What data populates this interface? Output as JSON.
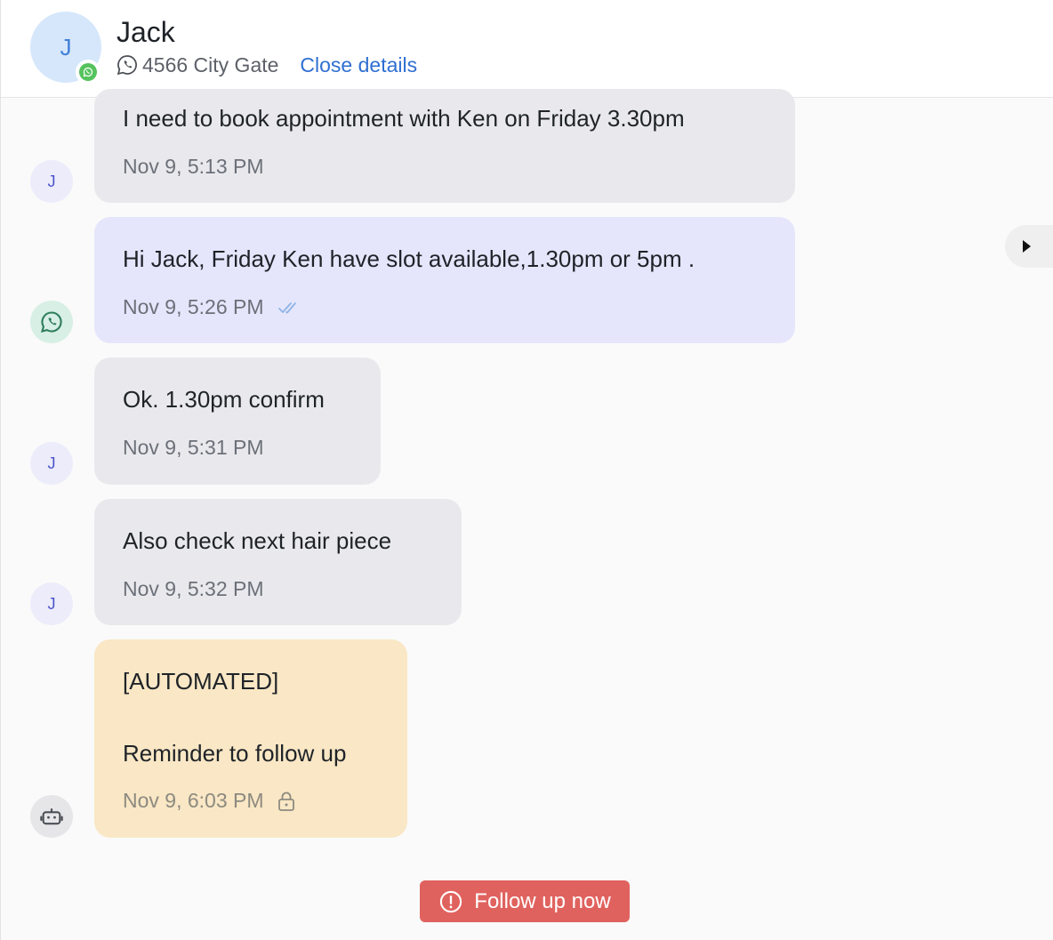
{
  "contact": {
    "initial": "J",
    "name": "Jack",
    "location": "4566 City Gate",
    "close_details_label": "Close details",
    "badge_icon": "whatsapp-icon"
  },
  "messages": [
    {
      "sender": "contact",
      "avatar_initial": "J",
      "text": "I need to book appointment with Ken on Friday 3.30pm",
      "time": "Nov 9, 5:13 PM"
    },
    {
      "sender": "agent",
      "avatar_icon": "whatsapp-icon",
      "text": "Hi Jack, Friday Ken have slot available,1.30pm or 5pm .",
      "time": "Nov 9, 5:26 PM",
      "status_icon": "double-check-icon"
    },
    {
      "sender": "contact",
      "avatar_initial": "J",
      "text": "Ok. 1.30pm confirm",
      "time": "Nov 9, 5:31 PM"
    },
    {
      "sender": "contact",
      "avatar_initial": "J",
      "text": "Also check next hair piece",
      "time": "Nov 9, 5:32 PM"
    },
    {
      "sender": "bot",
      "avatar_icon": "bot-icon",
      "text_line1": "[AUTOMATED]",
      "text_line2": "Reminder to follow up",
      "time": "Nov 9, 6:03 PM",
      "status_icon": "lock-icon"
    }
  ],
  "follow_up": {
    "label": "Follow up now",
    "icon": "alert-circle-icon"
  },
  "colors": {
    "accent_link": "#2f6fd1",
    "follow_up_bg": "#e0625e",
    "incoming_bubble": "#e9e9ed",
    "outgoing_bubble": "#e5e6fb",
    "note_bubble": "#f9e7c5"
  }
}
